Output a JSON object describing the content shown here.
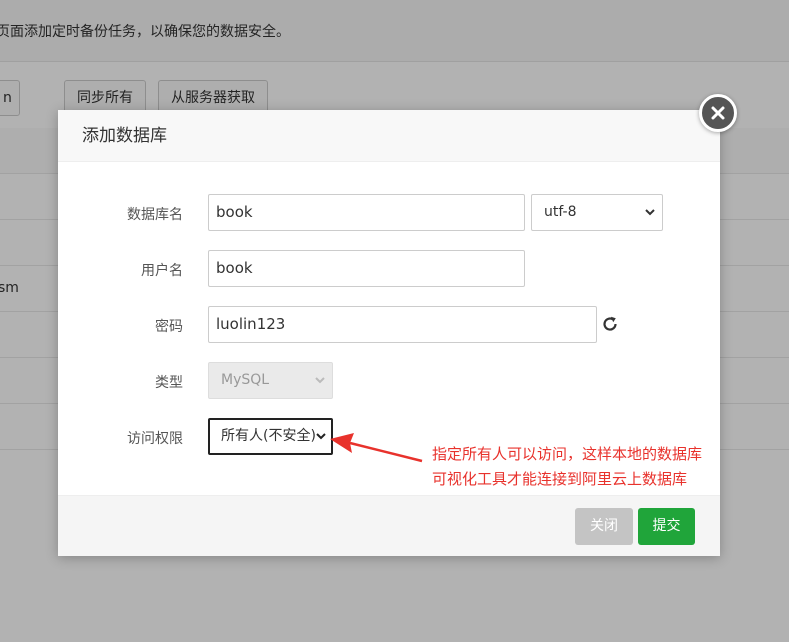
{
  "background": {
    "tip_text": "页面添加定时备份任务，以确保您的数据安全。",
    "partial_button": "n",
    "sync_all_button": "同步所有",
    "fetch_from_server_button": "从服务器获取",
    "table_row_text": "sm"
  },
  "modal": {
    "title": "添加数据库",
    "fields": {
      "db_name_label": "数据库名",
      "db_name_value": "book",
      "charset_value": "utf-8",
      "username_label": "用户名",
      "username_value": "book",
      "password_label": "密码",
      "password_value": "luolin123",
      "type_label": "类型",
      "type_value": "MySQL",
      "access_label": "访问权限",
      "access_value": "所有人(不安全)"
    },
    "buttons": {
      "close_label": "关闭",
      "submit_label": "提交"
    }
  },
  "annotation": {
    "text": "指定所有人可以访问，这样本地的数据库可视化工具才能连接到阿里云上数据库",
    "color": "#e8322c"
  },
  "colors": {
    "submit_button": "#20a53a",
    "close_button": "#c4c4c4"
  }
}
